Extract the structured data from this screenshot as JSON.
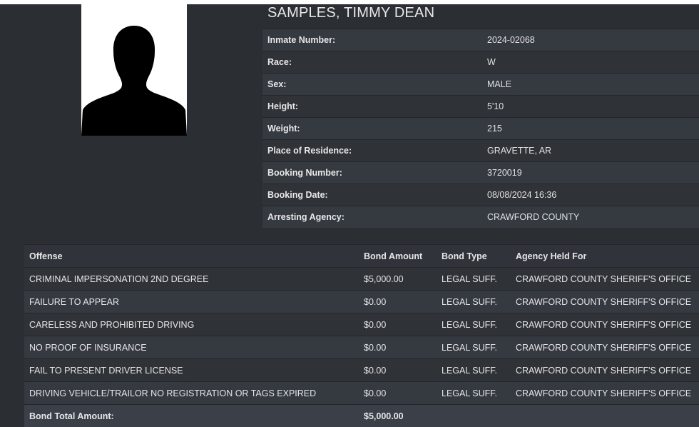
{
  "inmate": {
    "name": "SAMPLES, TIMMY DEAN",
    "details": [
      {
        "label": "Inmate Number:",
        "value": "2024-02068"
      },
      {
        "label": "Race:",
        "value": "W"
      },
      {
        "label": "Sex:",
        "value": "MALE"
      },
      {
        "label": "Height:",
        "value": "5'10"
      },
      {
        "label": "Weight:",
        "value": "215"
      },
      {
        "label": "Place of Residence:",
        "value": "GRAVETTE, AR"
      },
      {
        "label": "Booking Number:",
        "value": "3720019"
      },
      {
        "label": "Booking Date:",
        "value": "08/08/2024 16:36"
      },
      {
        "label": "Arresting Agency:",
        "value": "CRAWFORD COUNTY"
      }
    ]
  },
  "charges": {
    "headers": {
      "offense": "Offense",
      "bond_amount": "Bond Amount",
      "bond_type": "Bond Type",
      "agency": "Agency Held For"
    },
    "rows": [
      {
        "offense": "CRIMINAL IMPERSONATION 2ND DEGREE",
        "bond_amount": "$5,000.00",
        "bond_type": "LEGAL SUFF.",
        "agency": "CRAWFORD COUNTY SHERIFF'S OFFICE"
      },
      {
        "offense": "FAILURE TO APPEAR",
        "bond_amount": "$0.00",
        "bond_type": "LEGAL SUFF.",
        "agency": "CRAWFORD COUNTY SHERIFF'S OFFICE"
      },
      {
        "offense": "CARELESS AND PROHIBITED DRIVING",
        "bond_amount": "$0.00",
        "bond_type": "LEGAL SUFF.",
        "agency": "CRAWFORD COUNTY SHERIFF'S OFFICE"
      },
      {
        "offense": "NO PROOF OF INSURANCE",
        "bond_amount": "$0.00",
        "bond_type": "LEGAL SUFF.",
        "agency": "CRAWFORD COUNTY SHERIFF'S OFFICE"
      },
      {
        "offense": "FAIL TO PRESENT DRIVER LICENSE",
        "bond_amount": "$0.00",
        "bond_type": "LEGAL SUFF.",
        "agency": "CRAWFORD COUNTY SHERIFF'S OFFICE"
      },
      {
        "offense": "DRIVING VEHICLE/TRAILOR NO REGISTRATION OR TAGS EXPIRED",
        "bond_amount": "$0.00",
        "bond_type": "LEGAL SUFF.",
        "agency": "CRAWFORD COUNTY SHERIFF'S OFFICE"
      }
    ],
    "total_label": "Bond Total Amount:",
    "total_value": "$5,000.00"
  },
  "icons": {
    "photo": "person-silhouette-icon"
  },
  "colors": {
    "background": "#2b2e33",
    "row_light": "#353940",
    "row_dark": "#2f3237",
    "text": "#e6e6e6"
  }
}
